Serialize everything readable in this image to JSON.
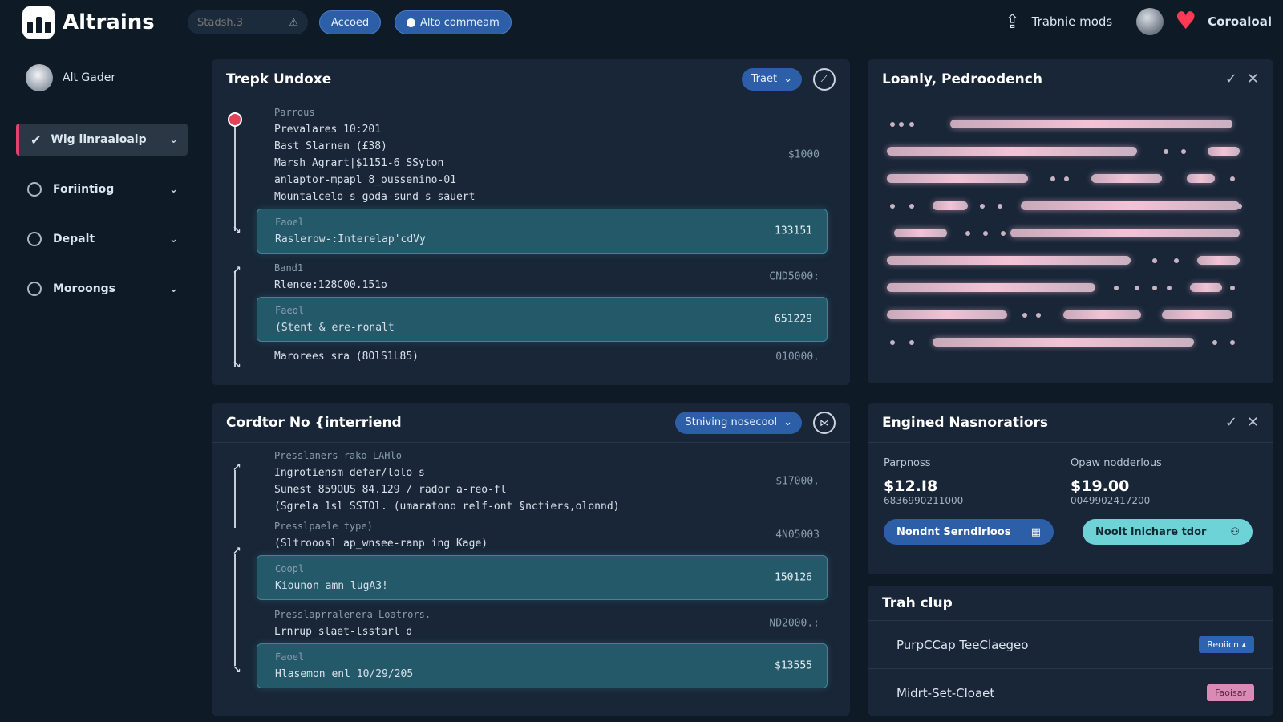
{
  "app": {
    "name": "Altrains"
  },
  "topbar": {
    "search_placeholder": "Stadsh.3",
    "pill_primary": "Accoed",
    "pill_secondary": "Alto commeam",
    "user_action": "Trabnie mods",
    "username": "Coroaloal"
  },
  "sidebar": {
    "header": "Alt Gader",
    "items": [
      {
        "label": "Wig linraaloalp",
        "active": true,
        "icon": "check-icon"
      },
      {
        "label": "Foriintiog",
        "active": false,
        "icon": "refresh-icon"
      },
      {
        "label": "Depalt",
        "active": false,
        "icon": "circle-icon"
      },
      {
        "label": "Moroongs",
        "active": false,
        "icon": "clock-icon"
      }
    ]
  },
  "panel_trades": {
    "title": "Trepk Undoxe",
    "dropdown": "Traet",
    "entries": [
      {
        "lines": [
          "Parrous",
          "Prevalares 10:201",
          "Bast Slarnen (£38)",
          "Marsh Agrart|$1151-6 SSyton",
          "anlaptor-mpapl 8_oussenino-01",
          "Mountalcelo s goda-sund s sauert"
        ],
        "amount": "$1000",
        "highlight": false
      },
      {
        "lines": [
          "Faoel",
          "Raslerow-:Interelap'cdVy"
        ],
        "amount": "133151",
        "highlight": true
      },
      {
        "lines": [
          "Band1",
          "Rlence:128C00.151o"
        ],
        "amount": "CND5000:",
        "highlight": false
      },
      {
        "lines": [
          "Faeol",
          "(Stent & ere-ronalt"
        ],
        "amount": "651229",
        "highlight": true
      },
      {
        "lines": [
          "Marorees sra (8OlS1L85)"
        ],
        "amount": "010000.",
        "highlight": false
      }
    ]
  },
  "panel_leads": {
    "title": "Loanly, Pedroodench",
    "rows": [
      {
        "dots": [
          0.015,
          0.04,
          0.07
        ],
        "segs": [
          [
            0.18,
            0.98
          ]
        ]
      },
      {
        "dots": [
          0.79,
          0.84
        ],
        "segs": [
          [
            0.0,
            0.71
          ],
          [
            0.91,
            1.0
          ]
        ]
      },
      {
        "dots": [
          0.47,
          0.51,
          0.98
        ],
        "segs": [
          [
            0.0,
            0.4
          ],
          [
            0.58,
            0.78
          ],
          [
            0.85,
            0.93
          ]
        ]
      },
      {
        "dots": [
          0.015,
          0.07,
          0.27,
          0.32,
          1.0
        ],
        "segs": [
          [
            0.13,
            0.23
          ],
          [
            0.38,
            1.0
          ]
        ]
      },
      {
        "dots": [
          0.23,
          0.28,
          0.33
        ],
        "segs": [
          [
            0.02,
            0.17
          ],
          [
            0.35,
            1.0
          ]
        ]
      },
      {
        "dots": [
          0.76,
          0.82
        ],
        "segs": [
          [
            0.0,
            0.69
          ],
          [
            0.88,
            1.0
          ]
        ]
      },
      {
        "dots": [
          0.65,
          0.71,
          0.76,
          0.8,
          0.98
        ],
        "segs": [
          [
            0.0,
            0.59
          ],
          [
            0.86,
            0.95
          ]
        ]
      },
      {
        "dots": [
          0.39,
          0.43
        ],
        "segs": [
          [
            0.0,
            0.34
          ],
          [
            0.5,
            0.72
          ],
          [
            0.78,
            0.98
          ]
        ]
      },
      {
        "dots": [
          0.015,
          0.07,
          0.93,
          0.98
        ],
        "segs": [
          [
            0.13,
            0.87
          ]
        ]
      }
    ]
  },
  "panel_flow": {
    "title": "Cordtor No {interriend",
    "dropdown": "Stniving nosecool",
    "entries": [
      {
        "lines": [
          "Presslaners rako LAHlo",
          "Ingrotiensm defer/lolo s",
          "Sunest 859OUS 84.129 / rador a-reo-fl",
          "(Sgrela 1sl SSTOl. (umaratono relf-ont §nctiers,olonnd)"
        ],
        "amount": "$17000.",
        "highlight": false
      },
      {
        "lines": [
          "Presslpaele type)",
          "(Sltrooosl ap_wnsee-ranp ing Kage)"
        ],
        "amount": "4N05003",
        "highlight": false
      },
      {
        "lines": [
          "Coopl",
          "Kiounon amn lugA3!"
        ],
        "amount": "150126",
        "highlight": true
      },
      {
        "lines": [
          "Presslaprralenera Loatrors.",
          "Lrnrup slaet-lsstarl d"
        ],
        "amount": "ND2000.:",
        "highlight": false
      },
      {
        "lines": [
          "Faoel",
          "Hlasemon enl 10/29/205"
        ],
        "amount": "$13555",
        "highlight": true
      }
    ]
  },
  "panel_orders": {
    "title": "Engined Nasnoratiors",
    "col1": {
      "label": "Parpnoss",
      "value": "$12.I8",
      "sub": "6836990211000"
    },
    "col2": {
      "label": "Opaw nodderlous",
      "value": "$19.00",
      "sub": "0049902417200"
    },
    "btn1": "Nondnt Serndirloos",
    "btn2": "Noolt lnichare tdor"
  },
  "panel_club": {
    "title": "Trah clup",
    "rows": [
      {
        "label": "PurpCCap TeeClaegeo",
        "tag": "Reoiicn ▴",
        "tag_color": "blue"
      },
      {
        "label": "Midrt-Set-Cloaet",
        "tag": "Faoisar",
        "tag_color": "pink"
      }
    ]
  },
  "colors": {
    "background": "#0f1a27",
    "panel": "#182637",
    "accent_blue": "#2d5fa8",
    "accent_pink": "#e2426c",
    "teal": "#6dd3d6"
  }
}
